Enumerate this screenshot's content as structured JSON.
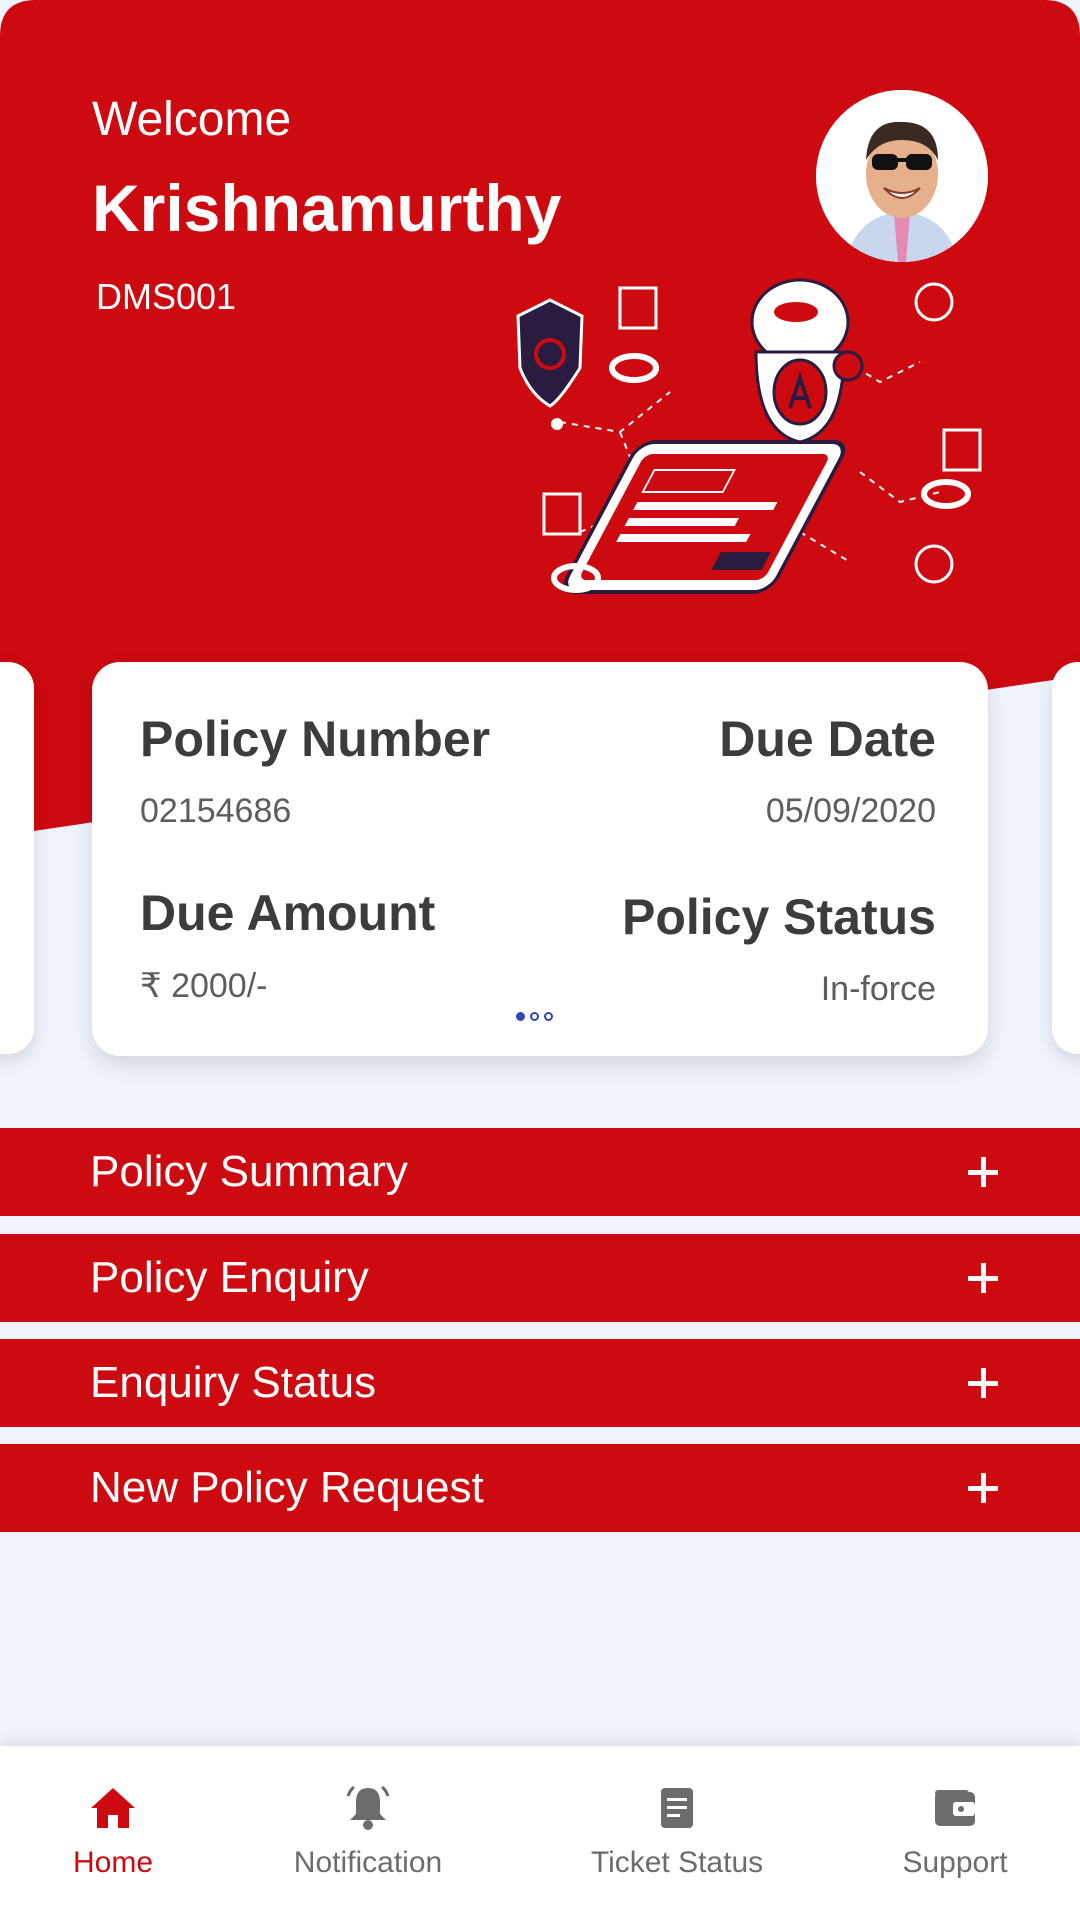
{
  "header": {
    "greeting": "Welcome",
    "user_name": "Krishnamurthy",
    "user_id": "DMS001"
  },
  "policy_card": {
    "policy_number_label": "Policy Number",
    "policy_number": "02154686",
    "due_date_label": "Due Date",
    "due_date": "05/09/2020",
    "due_amount_label": "Due Amount",
    "due_amount": "₹ 2000/-",
    "policy_status_label": "Policy Status",
    "policy_status": "In-force",
    "carousel_page": 1,
    "carousel_total": 3
  },
  "menu": [
    {
      "label": "Policy Summary"
    },
    {
      "label": "Policy Enquiry"
    },
    {
      "label": "Enquiry Status"
    },
    {
      "label": "New Policy Request"
    }
  ],
  "bottom_nav": [
    {
      "label": "Home",
      "icon": "home-icon",
      "active": true
    },
    {
      "label": "Notification",
      "icon": "bell-icon",
      "active": false
    },
    {
      "label": "Ticket Status",
      "icon": "document-icon",
      "active": false
    },
    {
      "label": "Support",
      "icon": "wallet-icon",
      "active": false
    }
  ],
  "colors": {
    "brand_red": "#CD0A10",
    "page_bg": "#EFF3FB",
    "carousel_dot": "#2F47B6",
    "nav_inactive": "#6C6C6C"
  }
}
